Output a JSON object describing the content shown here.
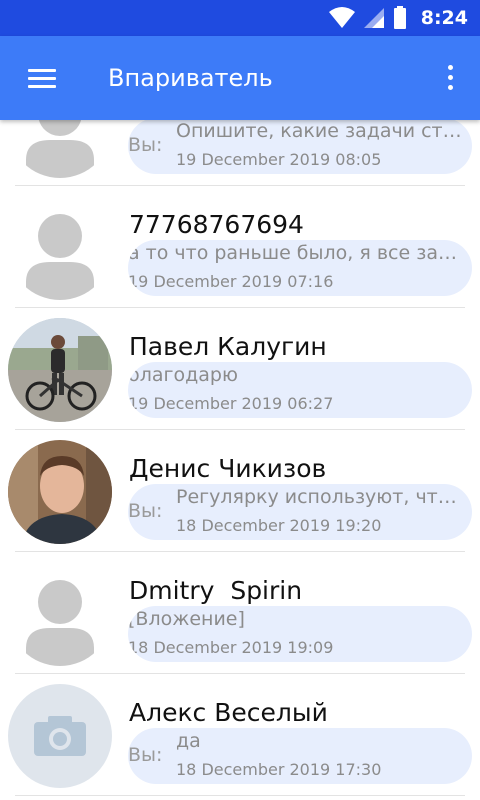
{
  "status_bar": {
    "time": "8:24",
    "icons": [
      "wifi-icon",
      "cell-signal-icon",
      "battery-icon"
    ]
  },
  "app_bar": {
    "title": "Впариватель",
    "icons": [
      "menu-icon",
      "more-vert-icon"
    ]
  },
  "colors": {
    "status_bar": "#1f4be0",
    "app_bar": "#3d7bf8",
    "bubble": "#e7eefd",
    "meta_text": "#8b8b8b"
  },
  "conversations": [
    {
      "name": "",
      "you_prefix": "Вы:",
      "message": "Опишите, какие задачи стоя…",
      "date": "19 December 2019 08:05",
      "avatar": "person-placeholder-icon"
    },
    {
      "name": "77768767694",
      "you_prefix": "",
      "message": "а то что раньше было, я все закр…",
      "date": "19 December 2019 07:16",
      "avatar": "person-placeholder-icon"
    },
    {
      "name": "Павел Калугин",
      "you_prefix": "",
      "message": "благодарю",
      "date": "19 December 2019 06:27",
      "avatar": "photo-man-with-bicycle"
    },
    {
      "name": "Денис Чикизов",
      "you_prefix": "Вы:",
      "message": "Регулярку используют, чтоб…",
      "date": "18 December 2019 19:20",
      "avatar": "photo-man-portrait"
    },
    {
      "name": "Dmitry  Spirin",
      "you_prefix": "",
      "message": "[Вложение]",
      "date": "18 December 2019 19:09",
      "avatar": "person-placeholder-icon"
    },
    {
      "name": "Алекс Веселый",
      "you_prefix": "Вы:",
      "message": "да",
      "date": "18 December 2019 17:30",
      "avatar": "camera-icon"
    }
  ]
}
